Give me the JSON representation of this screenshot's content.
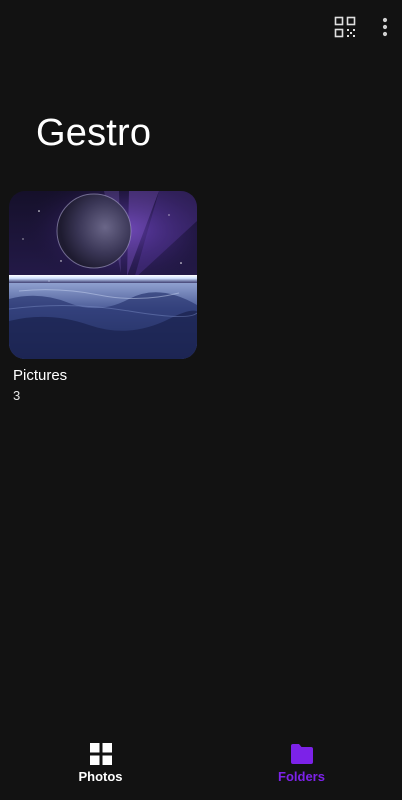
{
  "app": {
    "title": "Gestro"
  },
  "toolbar": {
    "actions": [
      {
        "icon": "qr-scan-icon"
      },
      {
        "icon": "more-vert-icon"
      }
    ]
  },
  "albums": [
    {
      "name": "Pictures",
      "count": "3",
      "thumbnail": "space-planet-image"
    }
  ],
  "bottom_nav": {
    "items": [
      {
        "label": "Photos",
        "icon": "grid-icon",
        "active": false
      },
      {
        "label": "Folders",
        "icon": "folder-icon",
        "active": true
      }
    ]
  },
  "colors": {
    "background": "#121212",
    "accent": "#7c22e8",
    "text": "#ffffff"
  }
}
